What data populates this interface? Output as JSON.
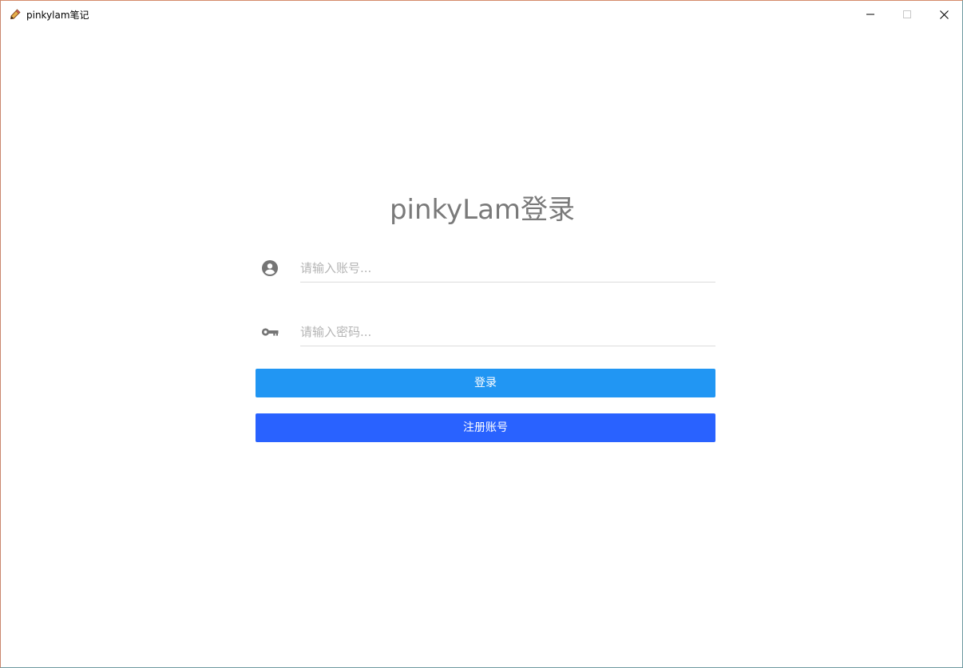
{
  "window": {
    "title": "pinkylam笔记",
    "app_icon": "pencil-icon",
    "controls": [
      "minimize-icon",
      "maximize-icon",
      "close-icon"
    ]
  },
  "login": {
    "heading": "pinkyLam登录",
    "account": {
      "icon": "account-circle-icon",
      "placeholder": "请输入账号...",
      "value": ""
    },
    "password": {
      "icon": "key-icon",
      "placeholder": "请输入密码...",
      "value": ""
    },
    "login_button": "登录",
    "register_button": "注册账号"
  },
  "colors": {
    "login_button": "#2196f3",
    "register_button": "#2962ff",
    "heading": "#7a7a7a",
    "icon": "#757575"
  }
}
